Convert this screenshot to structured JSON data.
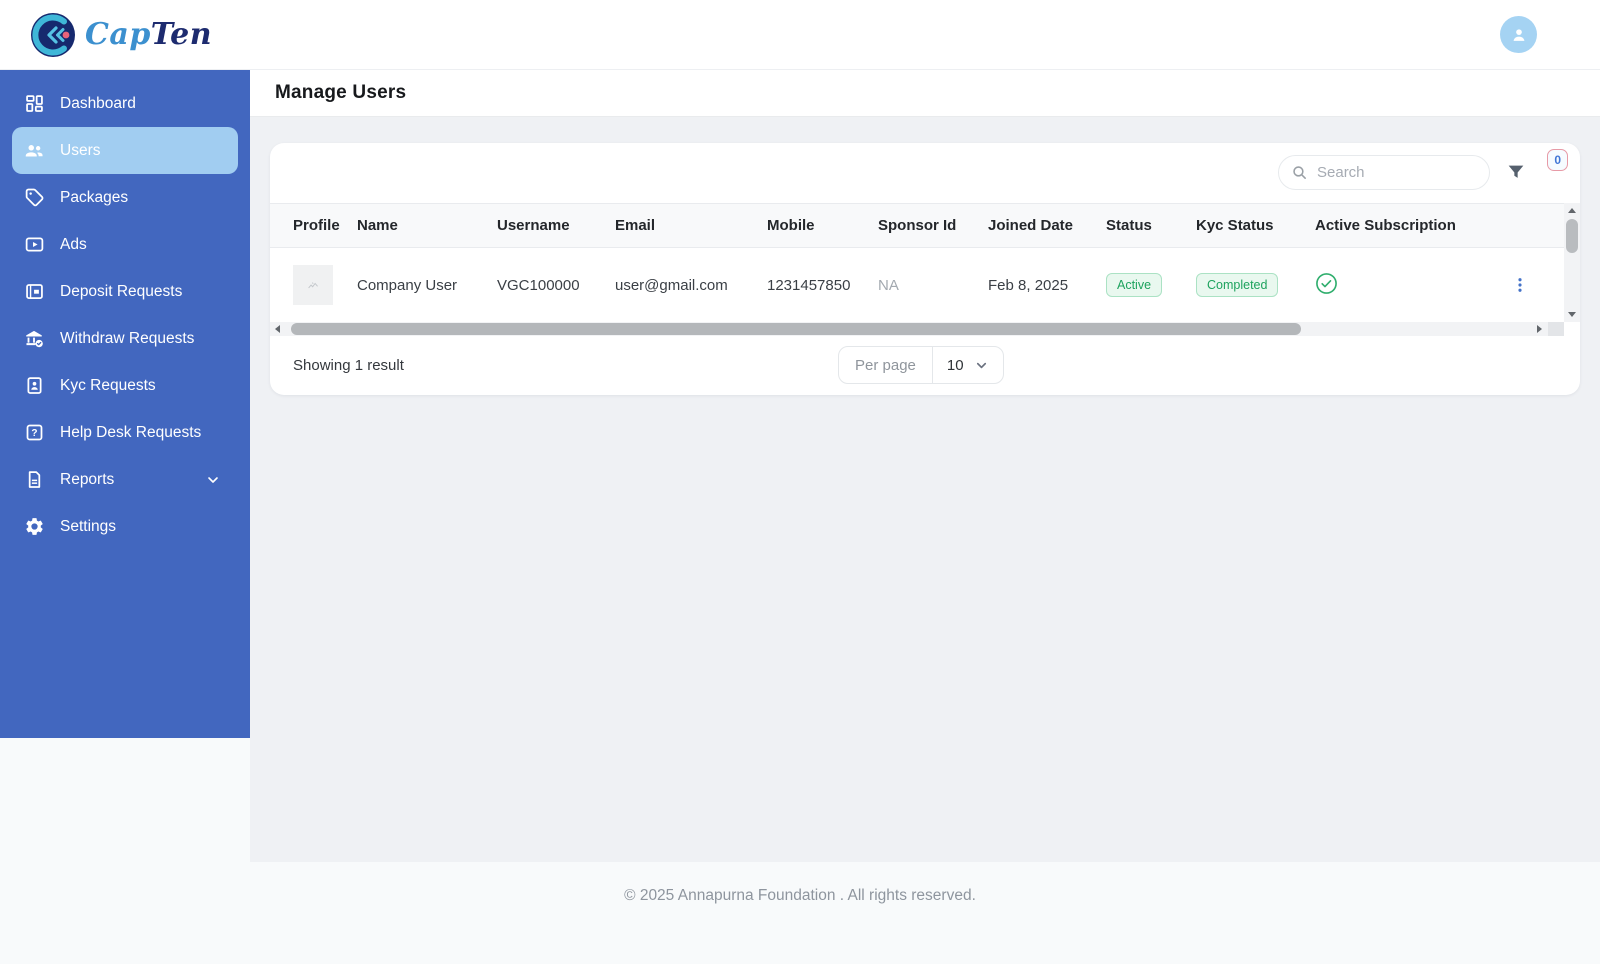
{
  "header": {
    "brand": {
      "part1": "Cap",
      "part2": "Ten"
    }
  },
  "sidebar": {
    "items": [
      {
        "label": "Dashboard",
        "icon": "dashboard-icon",
        "active": false
      },
      {
        "label": "Users",
        "icon": "users-icon",
        "active": true
      },
      {
        "label": "Packages",
        "icon": "tag-icon",
        "active": false
      },
      {
        "label": "Ads",
        "icon": "ads-icon",
        "active": false
      },
      {
        "label": "Deposit Requests",
        "icon": "deposit-icon",
        "active": false
      },
      {
        "label": "Withdraw Requests",
        "icon": "bank-check-icon",
        "active": false
      },
      {
        "label": "Kyc Requests",
        "icon": "id-document-icon",
        "active": false
      },
      {
        "label": "Help Desk Requests",
        "icon": "help-icon",
        "active": false
      },
      {
        "label": "Reports",
        "icon": "report-icon",
        "active": false,
        "expandable": true
      },
      {
        "label": "Settings",
        "icon": "gear-icon",
        "active": false
      }
    ]
  },
  "page": {
    "title": "Manage Users"
  },
  "toolbar": {
    "search_placeholder": "Search",
    "filter_count": "0"
  },
  "table": {
    "columns": [
      "Profile",
      "Name",
      "Username",
      "Email",
      "Mobile",
      "Sponsor Id",
      "Joined Date",
      "Status",
      "Kyc Status",
      "Active Subscription"
    ],
    "rows": [
      {
        "name": "Company User",
        "username": "VGC100000",
        "email": "user@gmail.com",
        "mobile": "1231457850",
        "sponsor_id": "NA",
        "joined_date": "Feb 8, 2025",
        "status": "Active",
        "kyc_status": "Completed",
        "active_subscription": true
      }
    ]
  },
  "pagination": {
    "summary": "Showing 1 result",
    "per_page_label": "Per page",
    "per_page_value": "10"
  },
  "footer": {
    "copyright": "© 2025 Annapurna Foundation . All rights reserved."
  },
  "colors": {
    "sidebar": "#4267bf",
    "sidebar_active": "#a1cdf1",
    "success": "#1ea35e",
    "accent": "#4472c4"
  }
}
